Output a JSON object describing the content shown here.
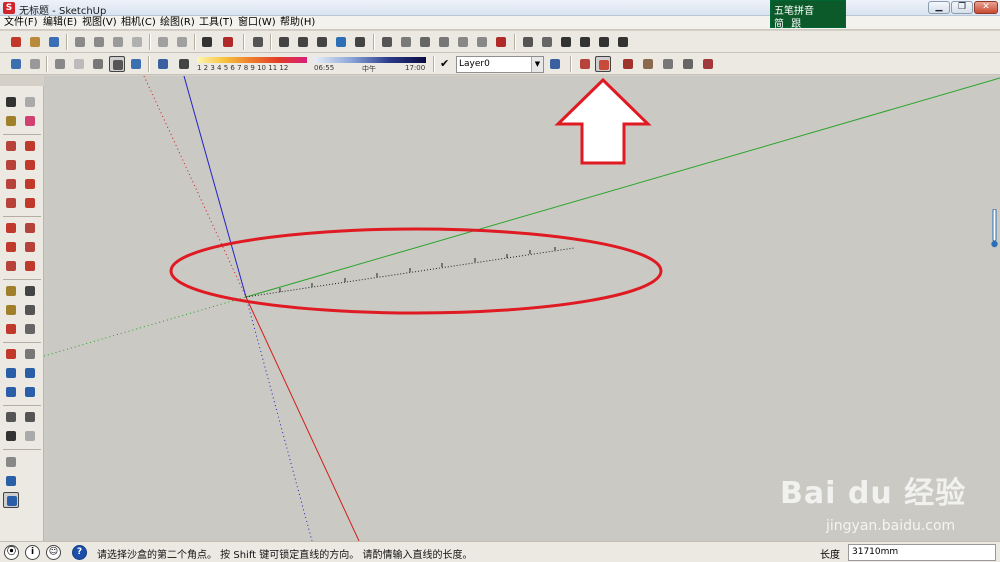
{
  "window": {
    "title": "无标题 - SketchUp",
    "app_icon": "sketchup-logo-icon"
  },
  "ime": {
    "row1": "五笔拼音",
    "row2": "简 跟"
  },
  "menu": [
    "文件(F)",
    "编辑(E)",
    "视图(V)",
    "相机(C)",
    "绘图(R)",
    "工具(T)",
    "窗口(W)",
    "帮助(H)"
  ],
  "shadow_scale": {
    "numbers": "1 2 3 4 5 6 7 8 9 10 11 12"
  },
  "time_scale": {
    "start": "06:55",
    "mid": "中午",
    "end": "17:00"
  },
  "layer": {
    "current": "Layer0",
    "checked": true
  },
  "status": {
    "message": "请选择沙盒的第二个角点。 按 Shift 键可锁定直线的方向。 请酌情输入直线的长度。",
    "length_label": "长度",
    "length_value": "31710mm"
  },
  "canvas": {
    "axes": {
      "red": "#d21e1e",
      "green": "#2aa42a",
      "blue": "#2222cc"
    },
    "background": "#cac9c3",
    "annotation_color": "#e01a22"
  },
  "watermark": {
    "brand": "Bai du 经验",
    "url": "jingyan.baidu.com"
  }
}
